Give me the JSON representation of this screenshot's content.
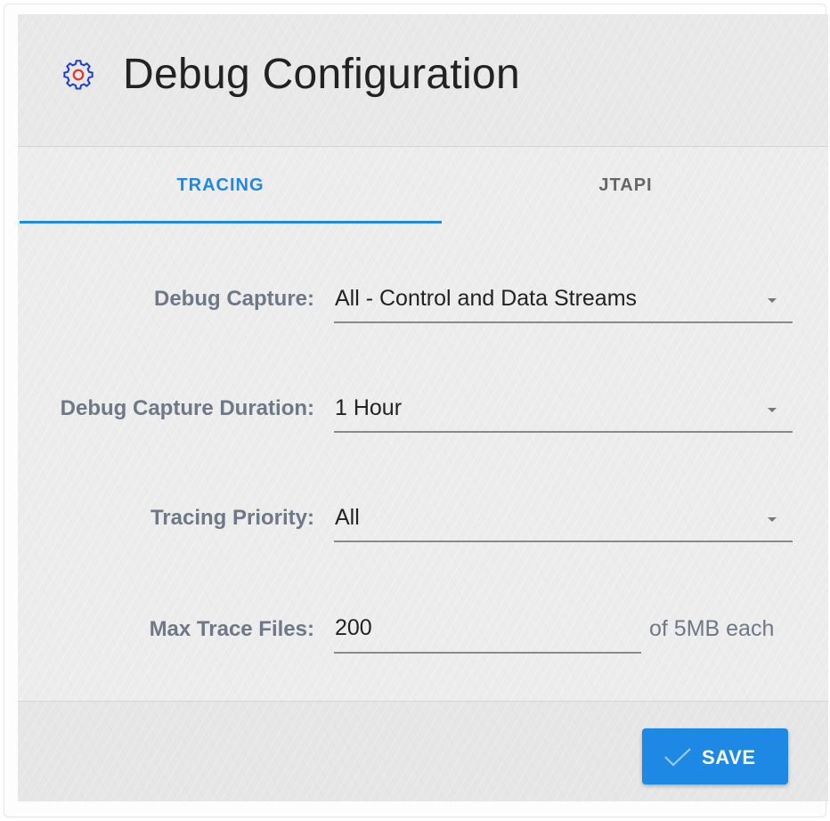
{
  "header": {
    "title": "Debug Configuration",
    "icon": "gear-icon",
    "icon_color": "#1e3fd6",
    "icon_center_color": "#e53935"
  },
  "tabs": [
    {
      "label": "TRACING",
      "active": true
    },
    {
      "label": "JTAPI",
      "active": false
    }
  ],
  "accent_color": "#1e88e5",
  "form": {
    "debug_capture": {
      "label": "Debug Capture:",
      "value": "All - Control and Data Streams"
    },
    "debug_capture_duration": {
      "label": "Debug Capture Duration:",
      "value": "1 Hour"
    },
    "tracing_priority": {
      "label": "Tracing Priority:",
      "value": "All"
    },
    "max_trace_files": {
      "label": "Max Trace Files:",
      "value": "200",
      "suffix": "of 5MB each"
    }
  },
  "footer": {
    "save_label": "SAVE",
    "save_icon": "check-icon"
  }
}
